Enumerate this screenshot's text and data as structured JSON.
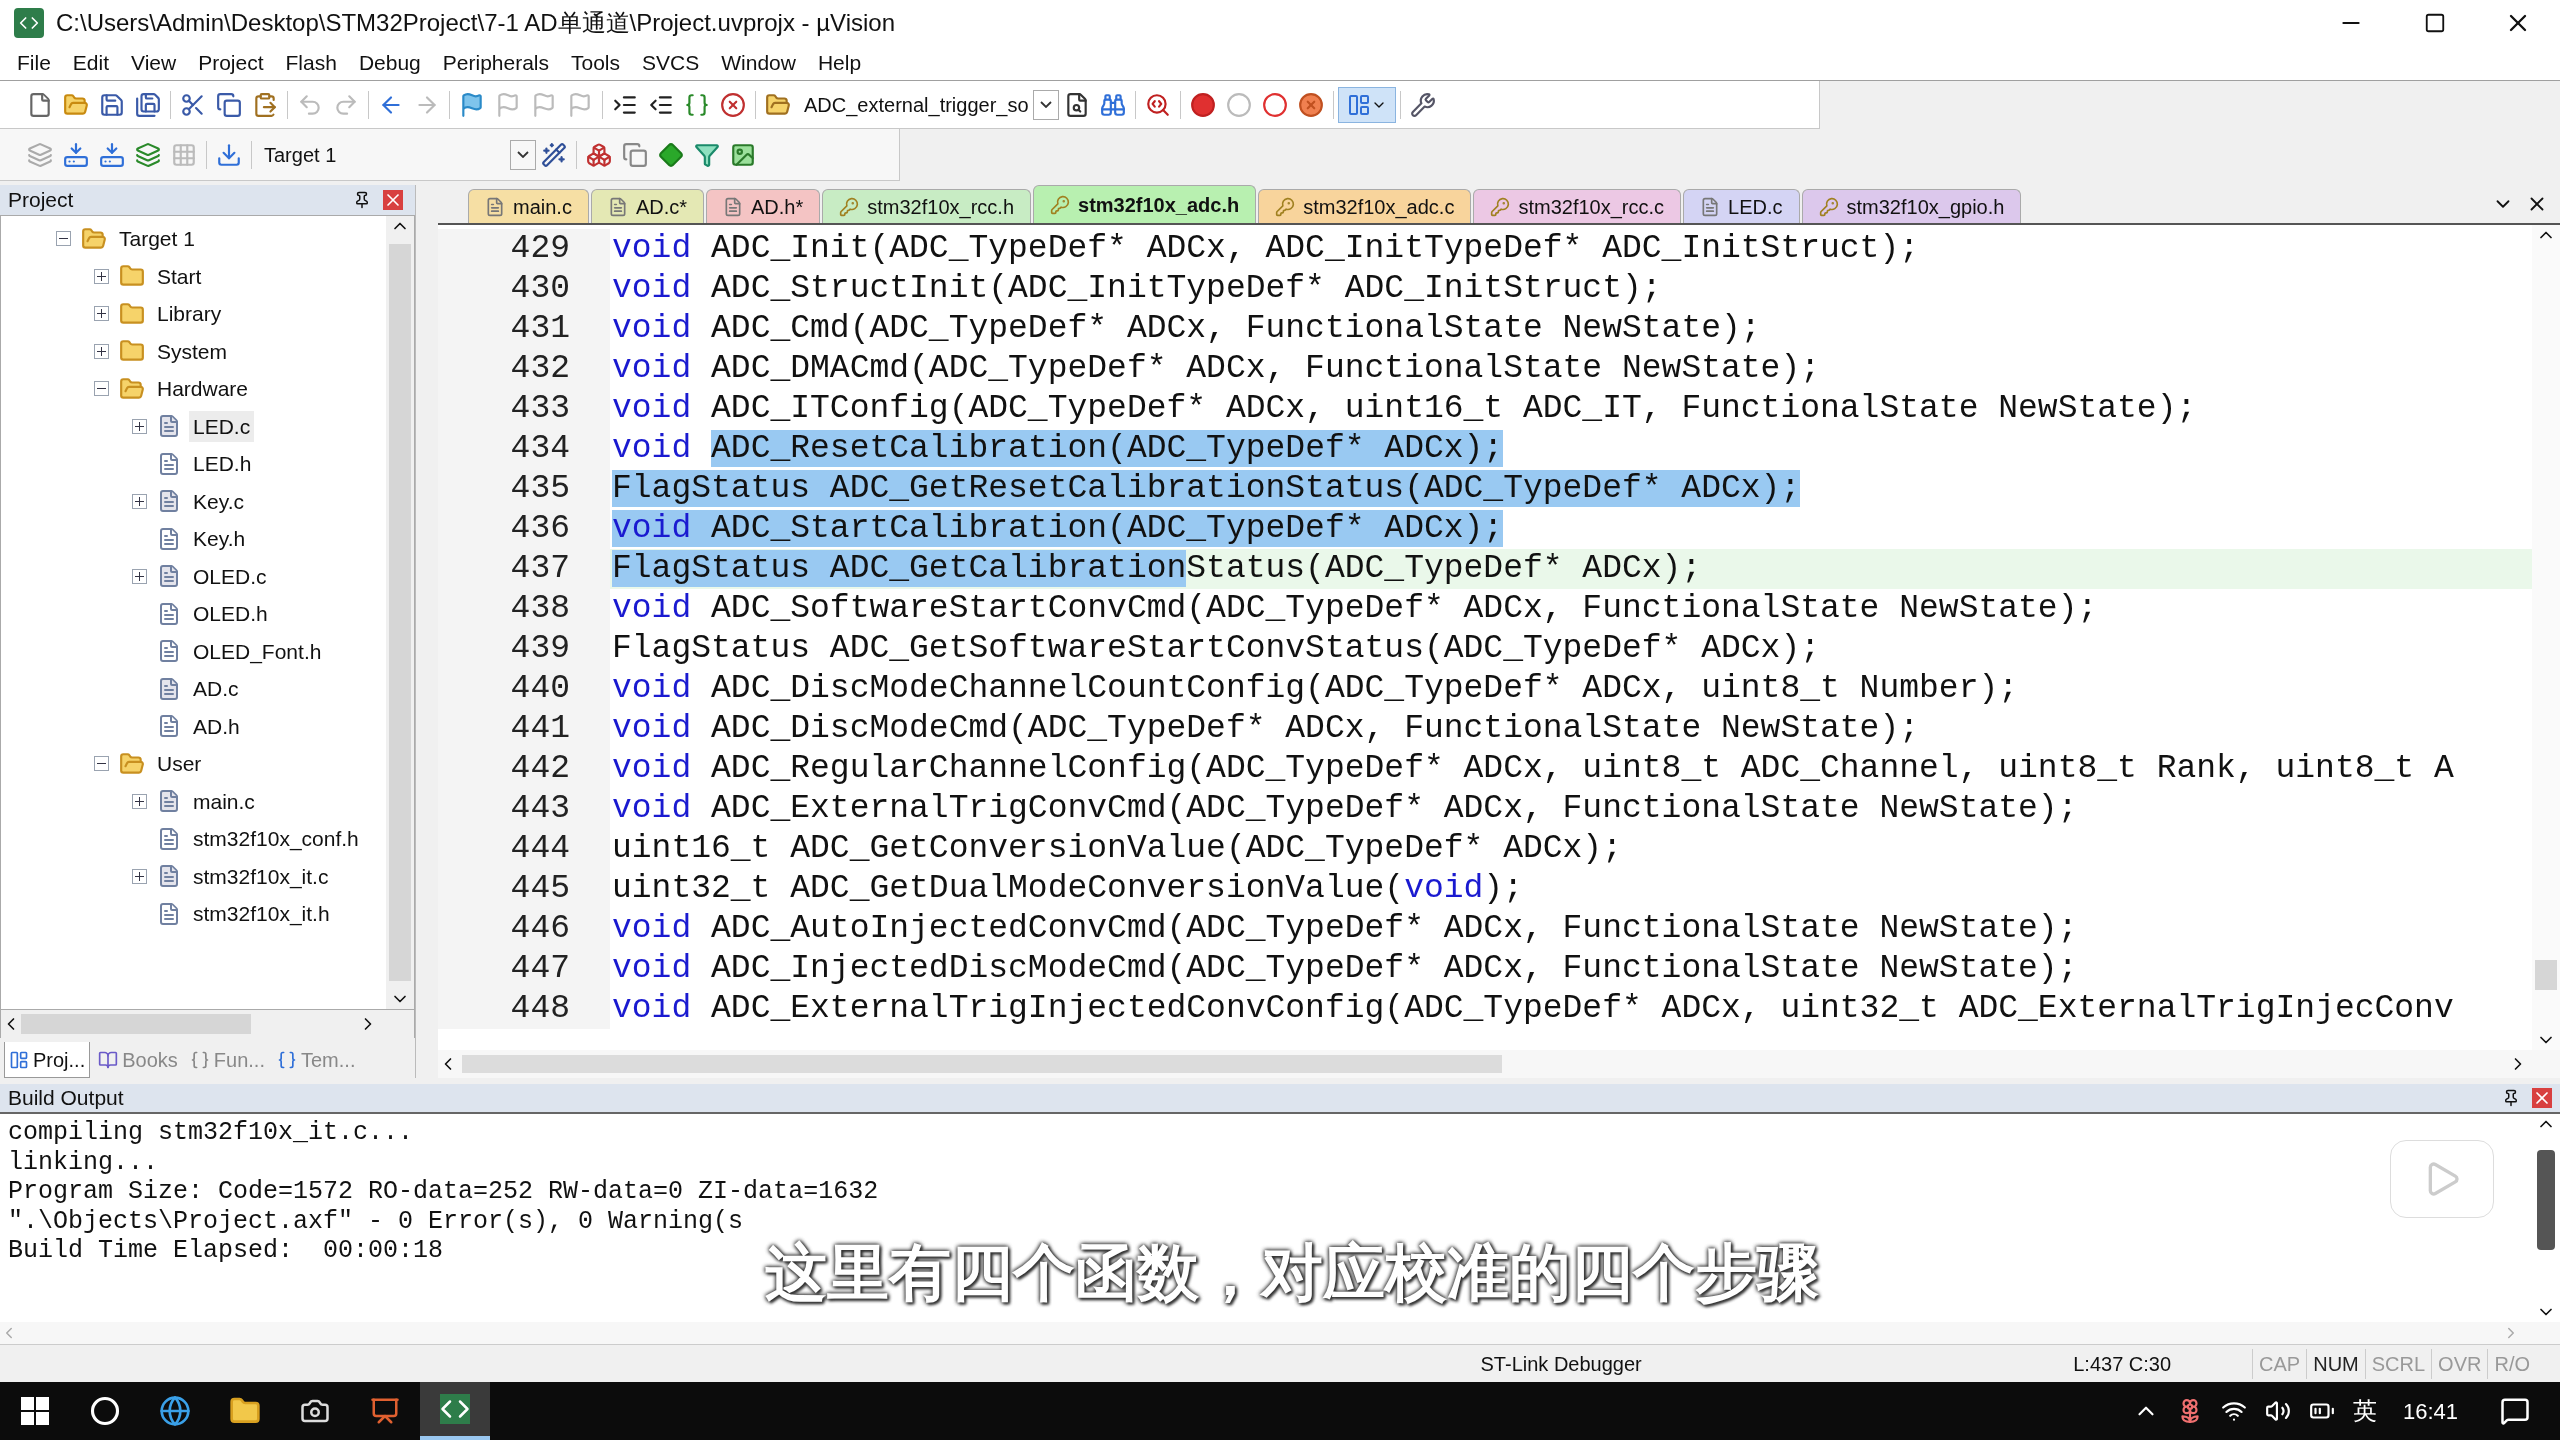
{
  "window": {
    "title": "C:\\Users\\Admin\\Desktop\\STM32Project\\7-1 AD单通道\\Project.uvprojx - µVision"
  },
  "menu": [
    "File",
    "Edit",
    "View",
    "Project",
    "Flash",
    "Debug",
    "Peripherals",
    "Tools",
    "SVCS",
    "Window",
    "Help"
  ],
  "toolbar": {
    "find_combo": "ADC_external_trigger_so",
    "target_combo": "Target 1"
  },
  "project": {
    "title": "Project",
    "tree": [
      {
        "label": "Target 1",
        "kind": "target",
        "expanded": true,
        "selected": false,
        "children": [
          {
            "label": "Start",
            "kind": "folder",
            "expanded": false,
            "selected": false
          },
          {
            "label": "Library",
            "kind": "folder",
            "expanded": false,
            "selected": false
          },
          {
            "label": "System",
            "kind": "folder",
            "expanded": false,
            "selected": false
          },
          {
            "label": "Hardware",
            "kind": "folder",
            "expanded": true,
            "selected": false,
            "children": [
              {
                "label": "LED.c",
                "kind": "source",
                "expanded": false,
                "selected": true
              },
              {
                "label": "LED.h",
                "kind": "header",
                "selected": false
              },
              {
                "label": "Key.c",
                "kind": "source",
                "expanded": false,
                "selected": false
              },
              {
                "label": "Key.h",
                "kind": "header",
                "selected": false
              },
              {
                "label": "OLED.c",
                "kind": "source",
                "expanded": false,
                "selected": false
              },
              {
                "label": "OLED.h",
                "kind": "header",
                "selected": false
              },
              {
                "label": "OLED_Font.h",
                "kind": "header",
                "selected": false
              },
              {
                "label": "AD.c",
                "kind": "leaf",
                "selected": false
              },
              {
                "label": "AD.h",
                "kind": "header",
                "selected": false
              }
            ]
          },
          {
            "label": "User",
            "kind": "folder",
            "expanded": true,
            "selected": false,
            "children": [
              {
                "label": "main.c",
                "kind": "source",
                "expanded": false,
                "selected": false
              },
              {
                "label": "stm32f10x_conf.h",
                "kind": "header",
                "selected": false
              },
              {
                "label": "stm32f10x_it.c",
                "kind": "source",
                "expanded": false,
                "selected": false
              },
              {
                "label": "stm32f10x_it.h",
                "kind": "header",
                "selected": false
              }
            ]
          }
        ]
      }
    ],
    "bottom_tabs": [
      {
        "label": "Proj...",
        "selected": true
      },
      {
        "label": "Books",
        "selected": false
      },
      {
        "label": "Fun...",
        "selected": false
      },
      {
        "label": "Tem...",
        "selected": false
      }
    ]
  },
  "editor": {
    "tabs": [
      {
        "label": "main.c",
        "color": "#f6dfa4",
        "readonly": false,
        "selected": false
      },
      {
        "label": "AD.c*",
        "color": "#e4e8b4",
        "readonly": false,
        "selected": false
      },
      {
        "label": "AD.h*",
        "color": "#f4c4c4",
        "readonly": false,
        "selected": false
      },
      {
        "label": "stm32f10x_rcc.h",
        "color": "#c8ecc4",
        "readonly": true,
        "selected": false
      },
      {
        "label": "stm32f10x_adc.h",
        "color": "#b8f0b0",
        "readonly": true,
        "selected": true
      },
      {
        "label": "stm32f10x_adc.c",
        "color": "#f8d49c",
        "readonly": true,
        "selected": false
      },
      {
        "label": "stm32f10x_rcc.c",
        "color": "#ecc8e4",
        "readonly": true,
        "selected": false
      },
      {
        "label": "LED.c",
        "color": "#d4d4f4",
        "readonly": false,
        "selected": false
      },
      {
        "label": "stm32f10x_gpio.h",
        "color": "#dcc8ec",
        "readonly": true,
        "selected": false
      }
    ],
    "lines": [
      {
        "number": "429",
        "current": false,
        "parts": [
          {
            "text": "void",
            "kind": "keyword",
            "selected": false
          },
          {
            "text": " ADC_Init(ADC_TypeDef* ADCx, ADC_InitTypeDef* ADC_InitStruct);",
            "kind": "plain",
            "selected": false
          }
        ]
      },
      {
        "number": "430",
        "current": false,
        "parts": [
          {
            "text": "void",
            "kind": "keyword",
            "selected": false
          },
          {
            "text": " ADC_StructInit(ADC_InitTypeDef* ADC_InitStruct);",
            "kind": "plain",
            "selected": false
          }
        ]
      },
      {
        "number": "431",
        "current": false,
        "parts": [
          {
            "text": "void",
            "kind": "keyword",
            "selected": false
          },
          {
            "text": " ADC_Cmd(ADC_TypeDef* ADCx, FunctionalState NewState);",
            "kind": "plain",
            "selected": false
          }
        ]
      },
      {
        "number": "432",
        "current": false,
        "parts": [
          {
            "text": "void",
            "kind": "keyword",
            "selected": false
          },
          {
            "text": " ADC_DMACmd(ADC_TypeDef* ADCx, FunctionalState NewState);",
            "kind": "plain",
            "selected": false
          }
        ]
      },
      {
        "number": "433",
        "current": false,
        "parts": [
          {
            "text": "void",
            "kind": "keyword",
            "selected": false
          },
          {
            "text": " ADC_ITConfig(ADC_TypeDef* ADCx, uint16_t ADC_IT, FunctionalState NewState);",
            "kind": "plain",
            "selected": false
          }
        ]
      },
      {
        "number": "434",
        "current": false,
        "parts": [
          {
            "text": "void ",
            "kind": "keyword",
            "selected": false
          },
          {
            "text": "ADC_ResetCalibration(ADC_TypeDef* ADCx);",
            "kind": "plain",
            "selected": true
          }
        ]
      },
      {
        "number": "435",
        "current": false,
        "parts": [
          {
            "text": "FlagStatus ADC_GetResetCalibrationStatus(ADC_TypeDef* ADCx);",
            "kind": "plain",
            "selected": true
          }
        ]
      },
      {
        "number": "436",
        "current": false,
        "parts": [
          {
            "text": "void",
            "kind": "keyword",
            "selected": true
          },
          {
            "text": " ADC_StartCalibration(ADC_TypeDef* ADCx);",
            "kind": "plain",
            "selected": true
          }
        ]
      },
      {
        "number": "437",
        "current": true,
        "parts": [
          {
            "text": "FlagStatus ADC_GetCalibration",
            "kind": "plain",
            "selected": true
          },
          {
            "text": "Status(ADC_TypeDef* ADCx);",
            "kind": "plain",
            "selected": false
          }
        ]
      },
      {
        "number": "438",
        "current": false,
        "parts": [
          {
            "text": "void",
            "kind": "keyword",
            "selected": false
          },
          {
            "text": " ADC_SoftwareStartConvCmd(ADC_TypeDef* ADCx, FunctionalState NewState);",
            "kind": "plain",
            "selected": false
          }
        ]
      },
      {
        "number": "439",
        "current": false,
        "parts": [
          {
            "text": "FlagStatus ADC_GetSoftwareStartConvStatus(ADC_TypeDef* ADCx);",
            "kind": "plain",
            "selected": false
          }
        ]
      },
      {
        "number": "440",
        "current": false,
        "parts": [
          {
            "text": "void",
            "kind": "keyword",
            "selected": false
          },
          {
            "text": " ADC_DiscModeChannelCountConfig(ADC_TypeDef* ADCx, uint8_t Number);",
            "kind": "plain",
            "selected": false
          }
        ]
      },
      {
        "number": "441",
        "current": false,
        "parts": [
          {
            "text": "void",
            "kind": "keyword",
            "selected": false
          },
          {
            "text": " ADC_DiscModeCmd(ADC_TypeDef* ADCx, FunctionalState NewState);",
            "kind": "plain",
            "selected": false
          }
        ]
      },
      {
        "number": "442",
        "current": false,
        "parts": [
          {
            "text": "void",
            "kind": "keyword",
            "selected": false
          },
          {
            "text": " ADC_RegularChannelConfig(ADC_TypeDef* ADCx, uint8_t ADC_Channel, uint8_t Rank, uint8_t A",
            "kind": "plain",
            "selected": false
          }
        ]
      },
      {
        "number": "443",
        "current": false,
        "parts": [
          {
            "text": "void",
            "kind": "keyword",
            "selected": false
          },
          {
            "text": " ADC_ExternalTrigConvCmd(ADC_TypeDef* ADCx, FunctionalState NewState);",
            "kind": "plain",
            "selected": false
          }
        ]
      },
      {
        "number": "444",
        "current": false,
        "parts": [
          {
            "text": "uint16_t ADC_GetConversionValue(ADC_TypeDef* ADCx);",
            "kind": "plain",
            "selected": false
          }
        ]
      },
      {
        "number": "445",
        "current": false,
        "parts": [
          {
            "text": "uint32_t ADC_GetDualModeConversionValue(",
            "kind": "plain",
            "selected": false
          },
          {
            "text": "void",
            "kind": "keyword",
            "selected": false
          },
          {
            "text": ");",
            "kind": "plain",
            "selected": false
          }
        ]
      },
      {
        "number": "446",
        "current": false,
        "parts": [
          {
            "text": "void",
            "kind": "keyword",
            "selected": false
          },
          {
            "text": " ADC_AutoInjectedConvCmd(ADC_TypeDef* ADCx, FunctionalState NewState);",
            "kind": "plain",
            "selected": false
          }
        ]
      },
      {
        "number": "447",
        "current": false,
        "parts": [
          {
            "text": "void",
            "kind": "keyword",
            "selected": false
          },
          {
            "text": " ADC_InjectedDiscModeCmd(ADC_TypeDef* ADCx, FunctionalState NewState);",
            "kind": "plain",
            "selected": false
          }
        ]
      },
      {
        "number": "448",
        "current": false,
        "parts": [
          {
            "text": "void",
            "kind": "keyword",
            "selected": false
          },
          {
            "text": " ADC_ExternalTrigInjectedConvConfig(ADC_TypeDef* ADCx, uint32_t ADC_ExternalTrigInjecConv",
            "kind": "plain",
            "selected": false
          }
        ]
      }
    ]
  },
  "build_output": {
    "title": "Build Output",
    "lines": [
      "compiling stm32f10x_it.c...",
      "linking...",
      "Program Size: Code=1572 RO-data=252 RW-data=0 ZI-data=1632",
      "\".\\Objects\\Project.axf\" - 0 Error(s), 0 Warning(s",
      "Build Time Elapsed:  00:00:18"
    ]
  },
  "subtitle": "这里有四个函数，对应校准的四个步骤",
  "status_bar": {
    "debugger": "ST-Link Debugger",
    "position": "L:437 C:30",
    "indicators": [
      {
        "label": "CAP",
        "on": false
      },
      {
        "label": "NUM",
        "on": true
      },
      {
        "label": "SCRL",
        "on": false
      },
      {
        "label": "OVR",
        "on": false
      },
      {
        "label": "R/O",
        "on": false
      }
    ]
  },
  "taskbar": {
    "apps": [
      {
        "selected": false
      },
      {
        "selected": false
      },
      {
        "selected": false
      },
      {
        "selected": false
      },
      {
        "selected": false
      },
      {
        "selected": false
      },
      {
        "selected": true
      }
    ],
    "ime": "英",
    "clock": "16:41"
  }
}
